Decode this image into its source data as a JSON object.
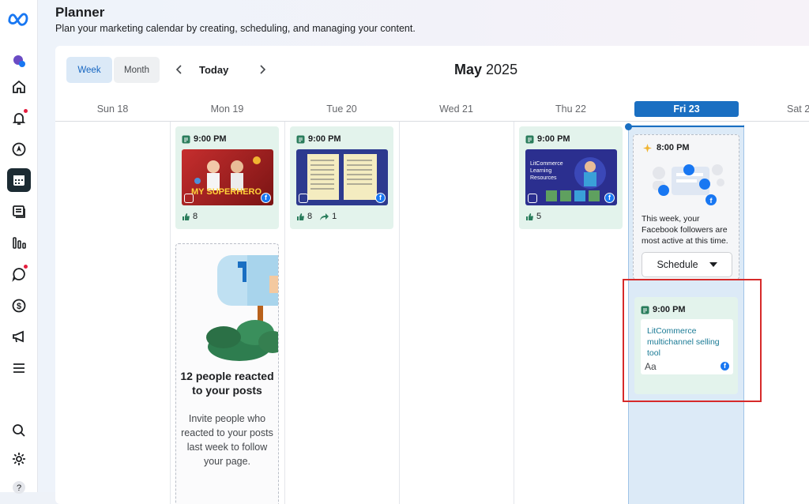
{
  "header": {
    "title": "Planner",
    "subtitle": "Plan your marketing calendar by creating, scheduling, and managing your content."
  },
  "toolbar": {
    "week_label": "Week",
    "month_label": "Month",
    "today_label": "Today",
    "month_name": "May",
    "year": "2025"
  },
  "days": [
    "Sun 18",
    "Mon 19",
    "Tue 20",
    "Wed 21",
    "Thu 22",
    "Fri 23",
    "Sat 2"
  ],
  "posts": {
    "mon": {
      "time": "9:00 PM",
      "likes": "8",
      "thumb_text": "MY SUPERHERO"
    },
    "tue": {
      "time": "9:00 PM",
      "likes": "8",
      "shares": "1"
    },
    "thu": {
      "time": "9:00 PM",
      "likes": "5",
      "thumb_text": "LitCommerce Learning Resources"
    },
    "fri": {
      "time": "9:00 PM",
      "text": "LitCommerce multichannel selling tool",
      "aa": "Aa"
    }
  },
  "reach_card": {
    "title": "12 people reacted to your posts",
    "description": "Invite people who reacted to your posts last week to follow your page."
  },
  "insight": {
    "time": "8:00 PM",
    "text": "This week, your Facebook followers are most active at this time.",
    "schedule_label": "Schedule"
  },
  "colors": {
    "accent": "#1a6fc2",
    "post_bg": "#e3f3ec",
    "highlight": "#d62a2a"
  }
}
